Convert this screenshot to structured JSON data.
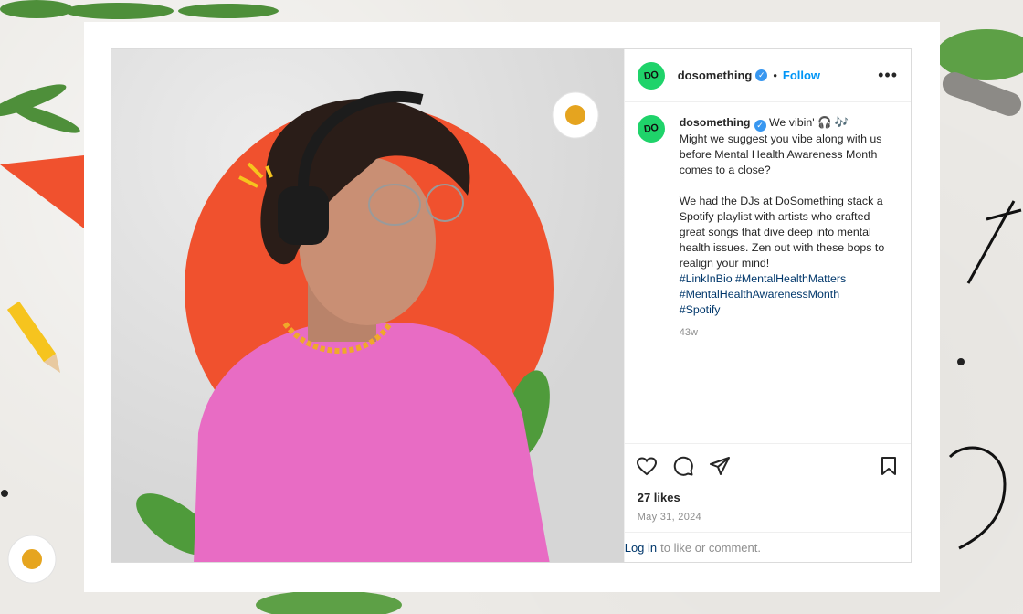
{
  "post": {
    "username": "dosomething",
    "avatar_text": "DO",
    "verified_mark": "✓",
    "separator": "•",
    "follow_label": "Follow",
    "more_label": "•••",
    "caption_lines": [
      "We vibin' 🎧 🎶",
      "Might we suggest you vibe along with us before Mental Health Awareness Month comes to a close?",
      "",
      "We had the DJs at DoSomething stack a Spotify playlist with artists who crafted great songs that dive deep into mental health issues. Zen out with these bops to realign your mind!"
    ],
    "hashtags_line1": "#LinkInBio #MentalHealthMatters",
    "hashtags_line2": "#MentalHealthAwarenessMonth",
    "hashtags_line3": "#Spotify",
    "time_ago": "43w",
    "likes": "27 likes",
    "date": "May 31, 2024",
    "login_link": "Log in",
    "login_text": "to like or comment."
  },
  "icons": {
    "like": "heart-icon",
    "comment": "comment-icon",
    "share": "share-icon",
    "save": "bookmark-icon",
    "more": "more-options-icon",
    "verified": "verified-badge-icon"
  },
  "colors": {
    "brand_green": "#1fd36a",
    "link_blue": "#0095f6",
    "hashtag_blue": "#00376b",
    "accent_orange": "#f0512e",
    "shirt_pink": "#e86cc4"
  }
}
